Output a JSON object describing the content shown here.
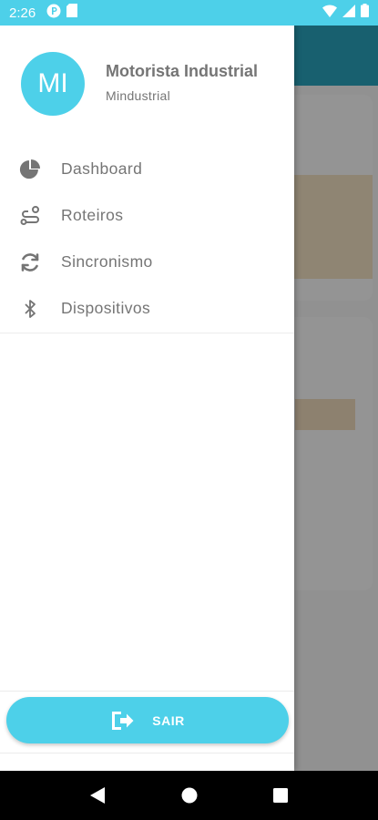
{
  "status_bar": {
    "time": "2:26",
    "left_icons": [
      "notification-p-icon",
      "sd-card-icon"
    ],
    "right_icons": [
      "wifi-icon",
      "signal-icon",
      "battery-icon"
    ]
  },
  "drawer": {
    "avatar_initials": "MI",
    "user_name": "Motorista Industrial",
    "user_company": "Mindustrial",
    "menu_items": [
      {
        "label": "Dashboard",
        "icon": "pie-chart-icon"
      },
      {
        "label": "Roteiros",
        "icon": "route-icon"
      },
      {
        "label": "Sincronismo",
        "icon": "sync-icon"
      },
      {
        "label": "Dispositivos",
        "icon": "bluetooth-icon"
      }
    ],
    "logout_label": "SAIR",
    "logout_icon": "exit-icon"
  },
  "colors": {
    "accent": "#4dd0e9",
    "toolbar": "#2aa6bf",
    "menu_text": "#757575"
  },
  "nav_bar": {
    "buttons": [
      "back-icon",
      "home-icon",
      "recents-icon"
    ]
  }
}
